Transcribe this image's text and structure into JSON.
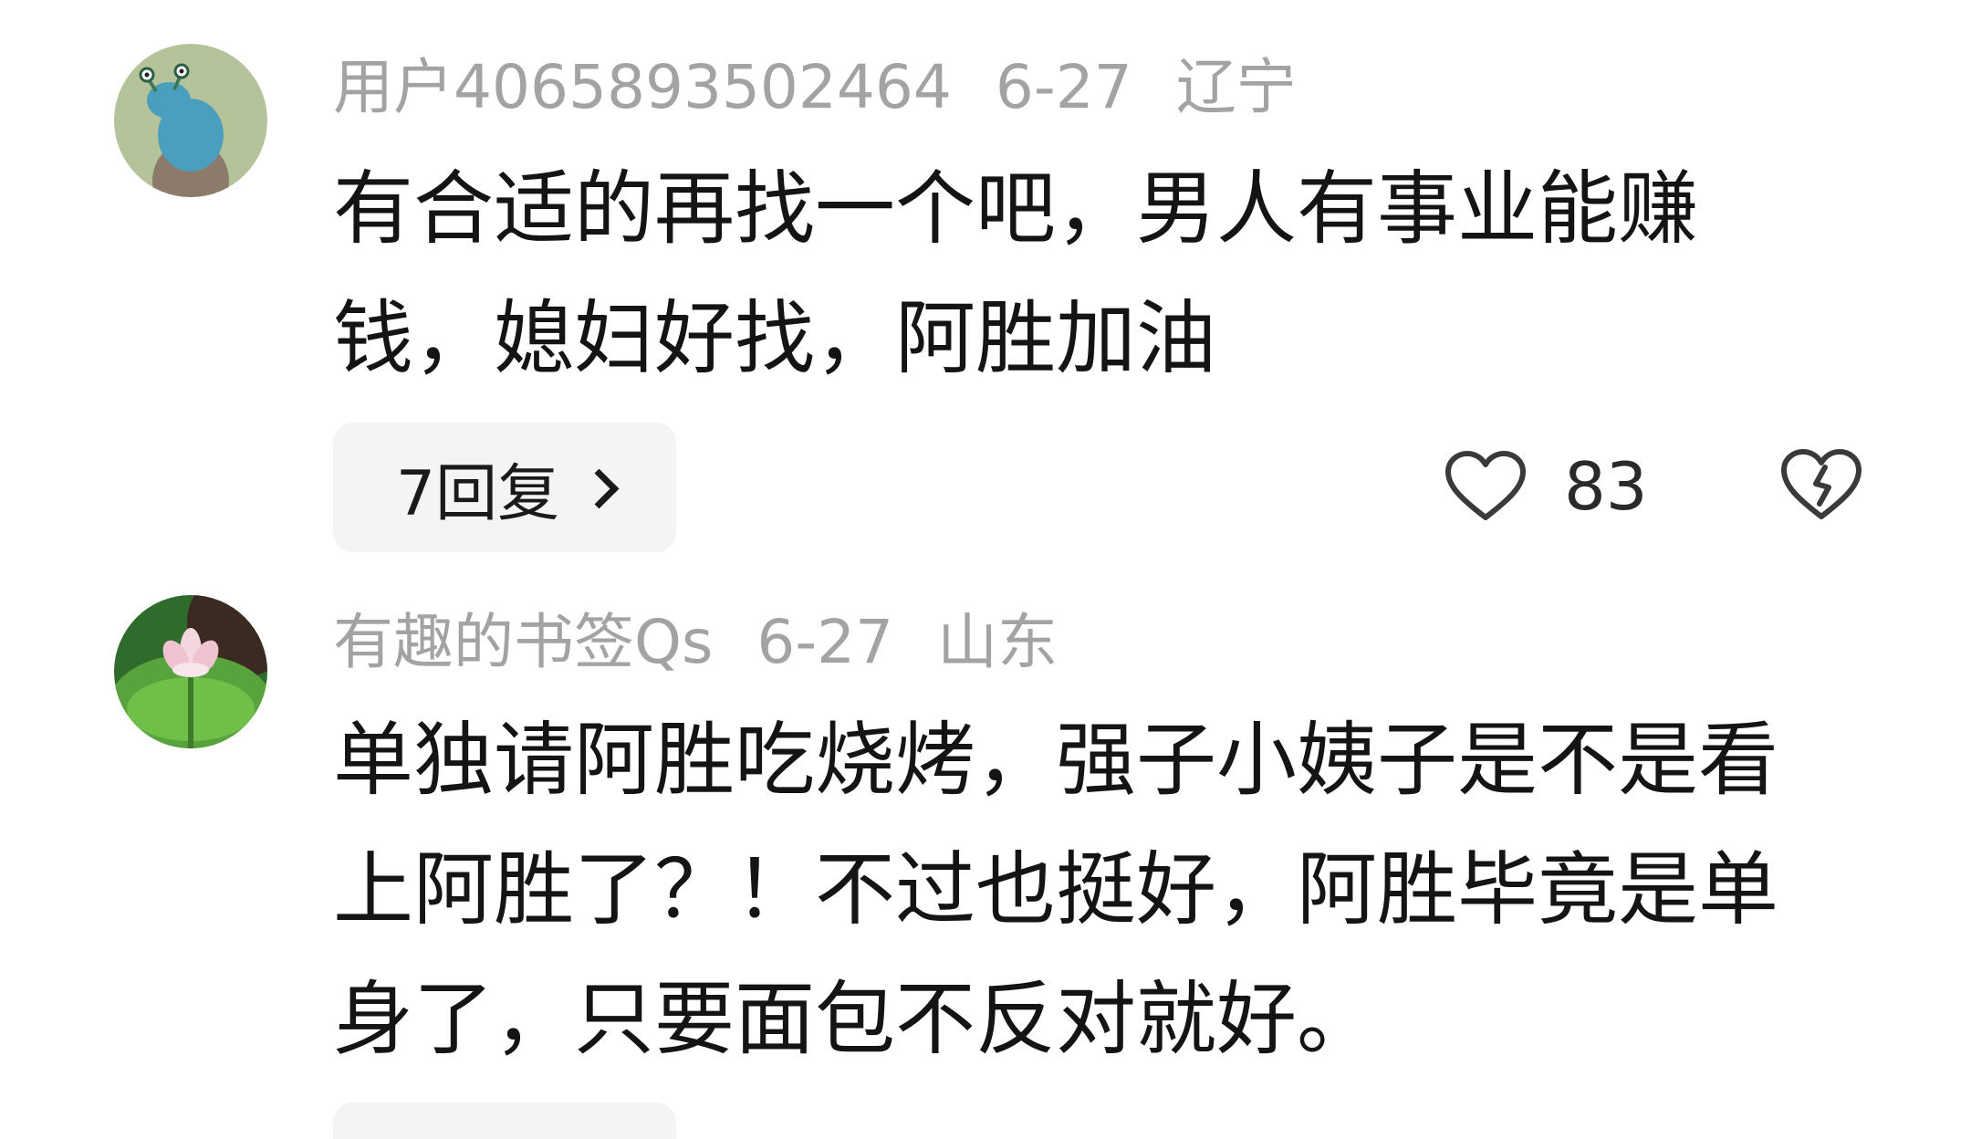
{
  "comments": [
    {
      "username": "用户4065893502464",
      "date": "6-27",
      "location": "辽宁",
      "text": "有合适的再找一个吧，男人有事业能赚钱，媳妇好找，阿胜加油",
      "reply_label": "7回复",
      "likes": "83",
      "avatar_icon": "cartoon-snail-avatar"
    },
    {
      "username": "有趣的书签Qs",
      "date": "6-27",
      "location": "山东",
      "text": "单独请阿胜吃烧烤，强子小姨子是不是看上阿胜了？！不过也挺好，阿胜毕竟是单身了，只要面包不反对就好。",
      "avatar_icon": "lotus-flower-avatar"
    }
  ],
  "icons": {
    "like": "heart-outline-icon",
    "dislike": "broken-heart-icon",
    "reply_chevron": "chevron-right-icon"
  },
  "colors": {
    "meta_text": "#a3a3a3",
    "body_text": "#141414",
    "reply_bg": "#f3f4f6"
  }
}
